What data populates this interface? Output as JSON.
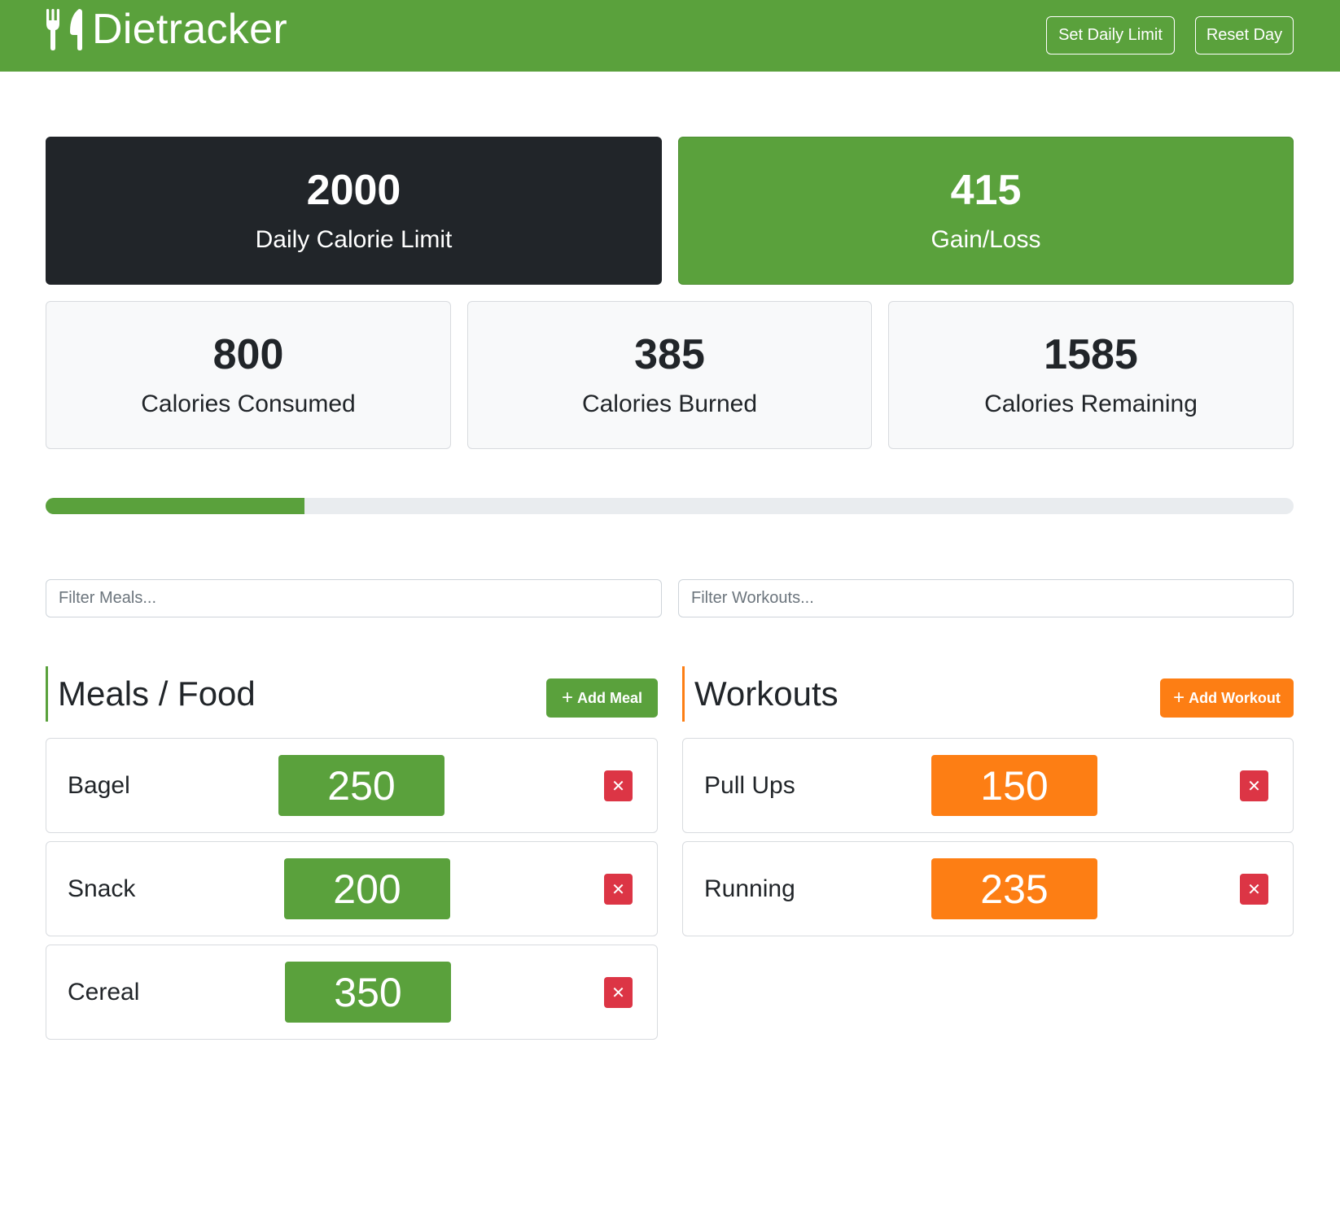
{
  "app": {
    "title": "Dietracker"
  },
  "nav": {
    "set_limit_label": "Set Daily Limit",
    "reset_label": "Reset Day"
  },
  "stats": {
    "limit": {
      "value": "2000",
      "label": "Daily Calorie Limit"
    },
    "gain_loss": {
      "value": "415",
      "label": "Gain/Loss"
    },
    "consumed": {
      "value": "800",
      "label": "Calories Consumed"
    },
    "burned": {
      "value": "385",
      "label": "Calories Burned"
    },
    "remaining": {
      "value": "1585",
      "label": "Calories Remaining"
    }
  },
  "progress": {
    "percent": 20.75
  },
  "filters": {
    "meals_placeholder": "Filter Meals...",
    "workouts_placeholder": "Filter Workouts..."
  },
  "meals": {
    "title": "Meals / Food",
    "add_label": "Add Meal",
    "items": [
      {
        "name": "Bagel",
        "calories": "250"
      },
      {
        "name": "Snack",
        "calories": "200"
      },
      {
        "name": "Cereal",
        "calories": "350"
      }
    ]
  },
  "workouts": {
    "title": "Workouts",
    "add_label": "Add Workout",
    "items": [
      {
        "name": "Pull Ups",
        "calories": "150"
      },
      {
        "name": "Running",
        "calories": "235"
      }
    ]
  },
  "icons": {
    "brand": "utensils-icon",
    "add": "plus-icon",
    "delete": "close-icon"
  },
  "colors": {
    "primary": "#5aa13c",
    "dark": "#212529",
    "workout": "#fd7e14",
    "danger": "#dc3545"
  }
}
